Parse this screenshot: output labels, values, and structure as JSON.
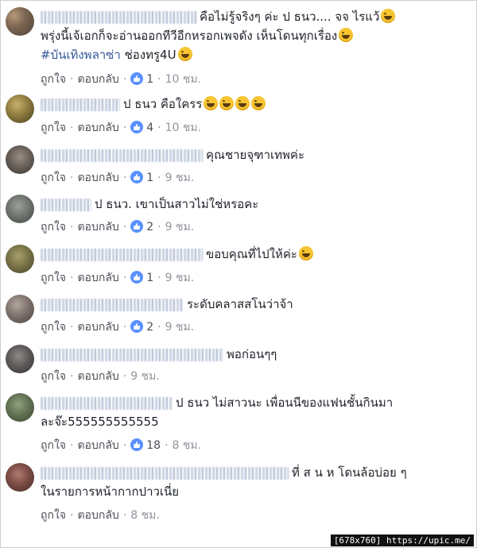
{
  "comments": [
    {
      "text": "คือไม่รู้จริงๆ ค่ะ ป ธนว.... จจ ไรแว้",
      "line2": "พรุ่งนี้เจ้เอกก็จะอ่านออกทีวีอีกหรอกเพจดัง เห็นโดนทุกเรื่อง",
      "hashtag": "#บันเทิงพลาซ่า",
      "line3_rest": " ช่องทรู4U",
      "like_label": "ถูกใจ",
      "reply_label": "ตอบกลับ",
      "reactions": "1",
      "time": "10 ชม."
    },
    {
      "text": "ป ธนว คือใครร",
      "like_label": "ถูกใจ",
      "reply_label": "ตอบกลับ",
      "reactions": "4",
      "time": "10 ชม."
    },
    {
      "text": "คุณชายจุฑาเทพค่ะ",
      "like_label": "ถูกใจ",
      "reply_label": "ตอบกลับ",
      "reactions": "1",
      "time": "9 ชม."
    },
    {
      "text": "ป ธนว. เขาเป็นสาวไม่ใช่หรอคะ",
      "like_label": "ถูกใจ",
      "reply_label": "ตอบกลับ",
      "reactions": "2",
      "time": "9 ชม."
    },
    {
      "text": "ขอบคุณที่ไปให้ค่ะ",
      "like_label": "ถูกใจ",
      "reply_label": "ตอบกลับ",
      "reactions": "1",
      "time": "9 ชม."
    },
    {
      "text": "ระดับคลาสสโนว่าจ้า",
      "like_label": "ถูกใจ",
      "reply_label": "ตอบกลับ",
      "reactions": "2",
      "time": "9 ชม."
    },
    {
      "text": "พอก่อนๆๆ",
      "like_label": "ถูกใจ",
      "reply_label": "ตอบกลับ",
      "time": "9 ชม."
    },
    {
      "text": "ป ธนว ไม่สาวนะ เพื่อนนีของแฟนชั้นกินมา",
      "line2": "ละจ๊ะ555555555555",
      "like_label": "ถูกใจ",
      "reply_label": "ตอบกลับ",
      "reactions": "18",
      "time": "8 ชม."
    },
    {
      "text": "ที่ ส น ห โดนล้อบ่อย ๆ",
      "line2": "ในรายการหน้ากากปาวเนี่ย",
      "like_label": "ถูกใจ",
      "reply_label": "ตอบกลับ",
      "time": "8 ชม."
    }
  ],
  "watermark": "[678x760] https://upic.me/",
  "colors": {
    "link": "#365899",
    "like_blue": "#5890ff",
    "meta_gray": "#90949c"
  }
}
